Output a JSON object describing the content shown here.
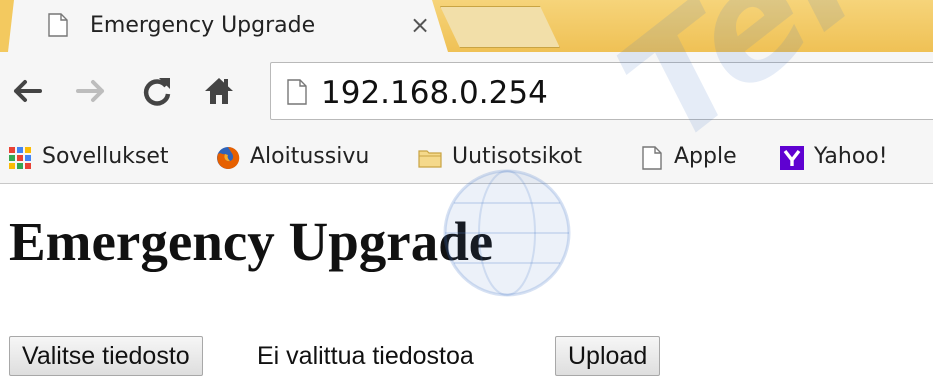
{
  "tab": {
    "title": "Emergency Upgrade",
    "close_glyph": "×",
    "icon": "document-icon"
  },
  "toolbar": {
    "back_icon": "back-arrow-icon",
    "forward_icon": "forward-arrow-icon",
    "reload_icon": "reload-icon",
    "home_icon": "home-icon",
    "url": "192.168.0.254"
  },
  "bookmarks": [
    {
      "label": "Sovellukset",
      "icon": "apps-grid-icon"
    },
    {
      "label": "Aloitussivu",
      "icon": "firefox-icon"
    },
    {
      "label": "Uutisotsikot",
      "icon": "folder-icon"
    },
    {
      "label": "Apple",
      "icon": "document-icon"
    },
    {
      "label": "Yahoo!",
      "icon": "yahoo-icon"
    }
  ],
  "page": {
    "title": "Emergency Upgrade",
    "choose_file_label": "Valitse tiedosto",
    "file_status": "Ei valittua tiedostoa",
    "upload_label": "Upload"
  },
  "watermark": {
    "text": "Tele"
  },
  "colors": {
    "tabstrip": "#f3c95f",
    "toolbar": "#f6f6f6",
    "yahoo": "#5f01d1",
    "folder": "#f5d98b"
  }
}
